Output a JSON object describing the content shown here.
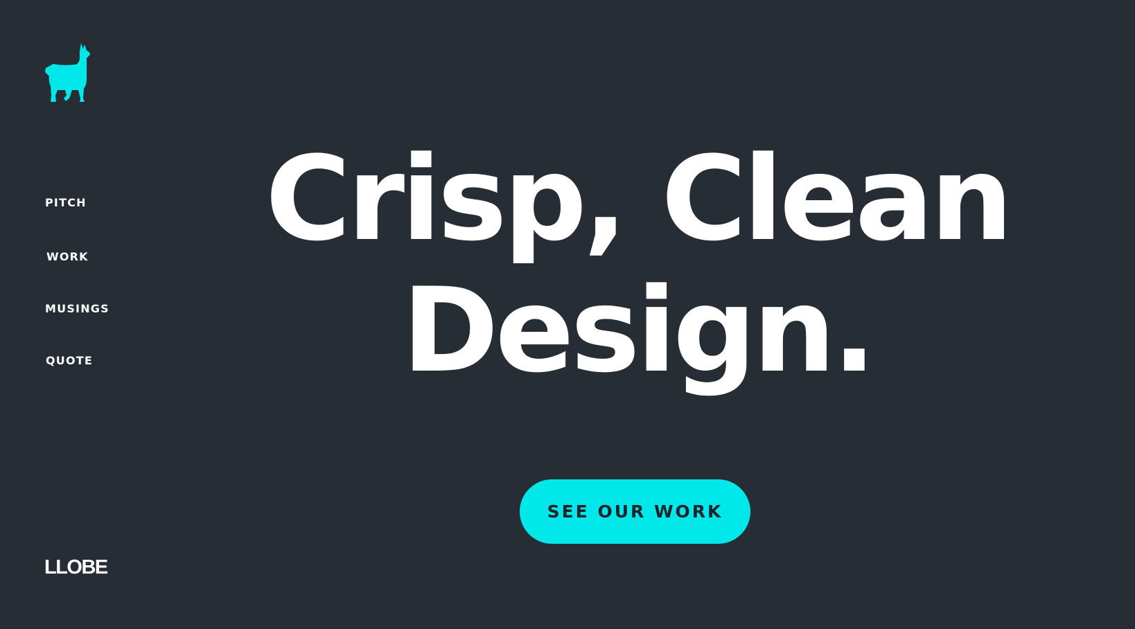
{
  "colors": {
    "background": "#272d34",
    "accent": "#00e8ea",
    "text": "#ffffff",
    "button_text": "#1d2329"
  },
  "logo": {
    "icon": "llama-icon"
  },
  "nav": {
    "items": [
      {
        "label": "PITCH"
      },
      {
        "label": "WORK"
      },
      {
        "label": "MUSINGS"
      },
      {
        "label": "QUOTE"
      }
    ]
  },
  "brand": {
    "name": "LLOBE"
  },
  "hero": {
    "line1": "Crisp, Clean",
    "line2": "Design."
  },
  "cta": {
    "label": "SEE OUR WORK"
  }
}
